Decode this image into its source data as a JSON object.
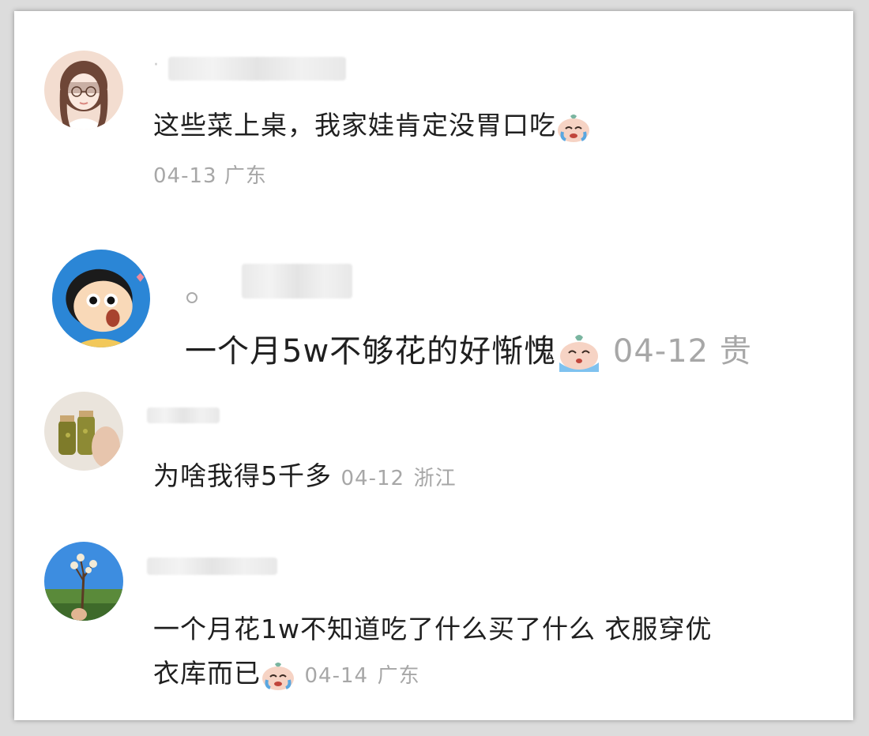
{
  "comments": [
    {
      "avatar": "girl-with-glasses-avatar",
      "text": "这些菜上桌，我家娃肯定没胃口吃",
      "emoji": "crying-face-emoji",
      "date": "04-13",
      "location": "广东"
    },
    {
      "avatar": "cartoon-boy-avatar",
      "text": "一个月5w不够花的好惭愧",
      "emoji": "crying-face-emoji",
      "date": "04-12",
      "location": "贵"
    },
    {
      "avatar": "jars-photo-avatar",
      "text": "为啥我得5千多",
      "date": "04-12",
      "location": "浙江"
    },
    {
      "avatar": "tree-sky-avatar",
      "text_line1": "一个月花1w不知道吃了什么买了什么 衣服穿优",
      "text_line2": "衣库而已",
      "emoji": "crying-face-emoji",
      "date": "04-14",
      "location": "广东"
    }
  ]
}
